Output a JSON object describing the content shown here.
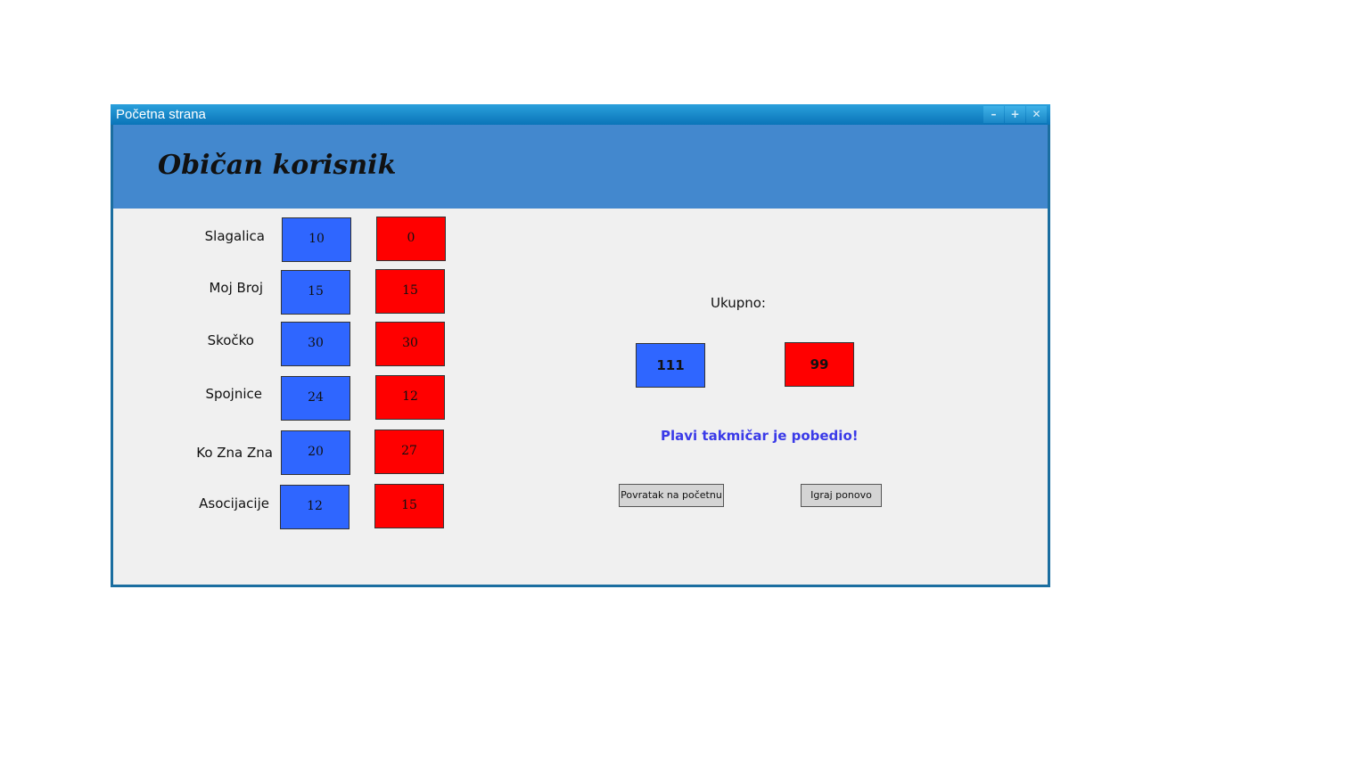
{
  "window": {
    "title": "Početna strana",
    "controls": {
      "minimize": "–",
      "maximize": "+",
      "close": "✕"
    }
  },
  "header": {
    "title": "Običan korisnik"
  },
  "rounds": [
    {
      "label": "Slagalica",
      "blue": "10",
      "red": "0"
    },
    {
      "label": "Moj Broj",
      "blue": "15",
      "red": "15"
    },
    {
      "label": "Skočko",
      "blue": "30",
      "red": "30"
    },
    {
      "label": "Spojnice",
      "blue": "24",
      "red": "12"
    },
    {
      "label": "Ko Zna Zna",
      "blue": "20",
      "red": "27"
    },
    {
      "label": "Asocijacije",
      "blue": "12",
      "red": "15"
    }
  ],
  "totals": {
    "label": "Ukupno:",
    "blue": "111",
    "red": "99"
  },
  "result_message": "Plavi takmičar je pobedio!",
  "buttons": {
    "back": "Povratak na početnu",
    "replay": "Igraj ponovo"
  },
  "colors": {
    "blue_player": "#2f66ff",
    "red_player": "#ff0000",
    "header_band": "#4388ce",
    "titlebar": "#0a74b8",
    "winner_text": "#3a3ae8"
  }
}
